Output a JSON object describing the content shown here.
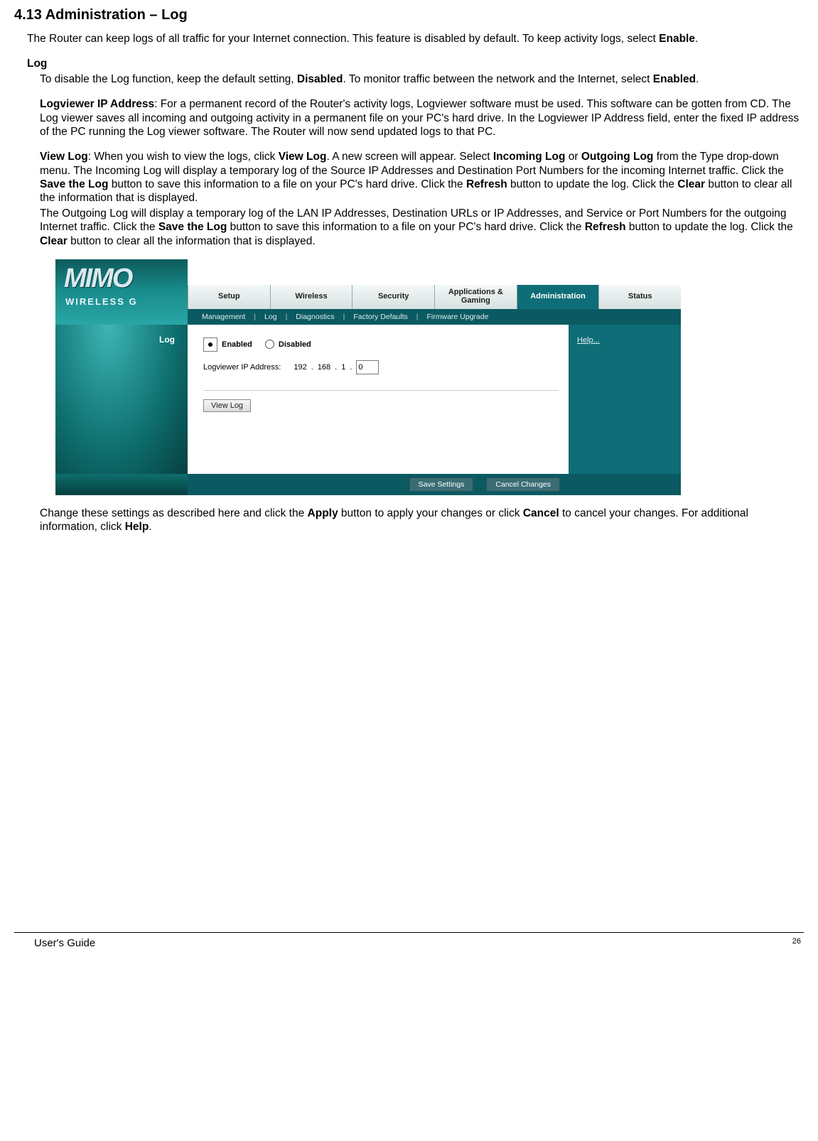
{
  "doc": {
    "section_title": "4.13 Administration – Log",
    "intro_pre": "The Router can keep logs of all traffic for your Internet connection. This feature is disabled by default. To keep activity logs, select ",
    "intro_bold": "Enable",
    "intro_post": ".",
    "log_heading": "Log",
    "log_p1_a": "To disable the Log function, keep the default setting, ",
    "log_p1_b": "Disabled",
    "log_p1_c": ". To monitor traffic between the network and the Internet, select ",
    "log_p1_d": "Enabled",
    "log_p1_e": ".",
    "log_p2_b1": "Logviewer IP Address",
    "log_p2_a": ": For a permanent record of the Router's activity logs, Logviewer software must be used. This software can be gotten from CD. The Log viewer saves all incoming and outgoing activity in a permanent file on your PC's hard drive. In the Logviewer IP Address field, enter the fixed IP address of the PC running the Log viewer software. The Router will now send updated logs to that PC.",
    "log_p3_b1": "View Log",
    "log_p3_t1": ": When you wish to view the logs, click ",
    "log_p3_b2": "View Log",
    "log_p3_t2": ". A new screen will appear. Select ",
    "log_p3_b3": "Incoming Log",
    "log_p3_t3": " or ",
    "log_p3_b4": "Outgoing Log",
    "log_p3_t4": " from the Type drop-down menu. The Incoming Log will display a temporary log of the Source IP Addresses and Destination Port Numbers for the incoming Internet traffic. Click the ",
    "log_p3_b5": "Save the Log",
    "log_p3_t5": " button to save this information to a file on your PC's hard drive. Click the ",
    "log_p3_b6": "Refresh",
    "log_p3_t6": " button to update the log. Click the ",
    "log_p3_b7": "Clear",
    "log_p3_t7": " button to clear all the information that is displayed.",
    "log_p4_t1": "The Outgoing Log will display a temporary log of the LAN IP Addresses, Destination URLs or IP Addresses, and Service or Port Numbers for the outgoing Internet traffic. Click the ",
    "log_p4_b1": "Save the Log",
    "log_p4_t2": " button to save this information to a file on your PC's hard drive. Click the ",
    "log_p4_b2": "Refresh",
    "log_p4_t3": " button to update the log. Click the ",
    "log_p4_b3": "Clear",
    "log_p4_t4": " button to clear all the information that is displayed.",
    "closing_t1": "Change these settings as described here and click the ",
    "closing_b1": "Apply",
    "closing_t2": " button to apply your changes or click ",
    "closing_b2": "Cancel",
    "closing_t3": " to cancel your changes. For additional information, click ",
    "closing_b3": "Help",
    "closing_t4": "."
  },
  "router": {
    "logo_main": "MIMO",
    "logo_sub": "WIRELESS G",
    "tabs": {
      "t0": "Setup",
      "t1": "Wireless",
      "t2": "Security",
      "t3": "Applications & Gaming",
      "t4": "Administration",
      "t5": "Status"
    },
    "subnav": {
      "s0": "Management",
      "s1": "Log",
      "s2": "Diagnostics",
      "s3": "Factory Defaults",
      "s4": "Firmware Upgrade"
    },
    "side_label": "Log",
    "radio_enabled": "Enabled",
    "radio_disabled": "Disabled",
    "ip_label": "Logviewer IP Address:",
    "ip_o1": "192",
    "ip_o2": "168",
    "ip_o3": "1",
    "ip_o4": "0",
    "view_log_btn": "View Log",
    "help_link": "Help...",
    "save_btn": "Save Settings",
    "cancel_btn": "Cancel Changes"
  },
  "footer": {
    "guide": "User's Guide",
    "page": "26"
  }
}
